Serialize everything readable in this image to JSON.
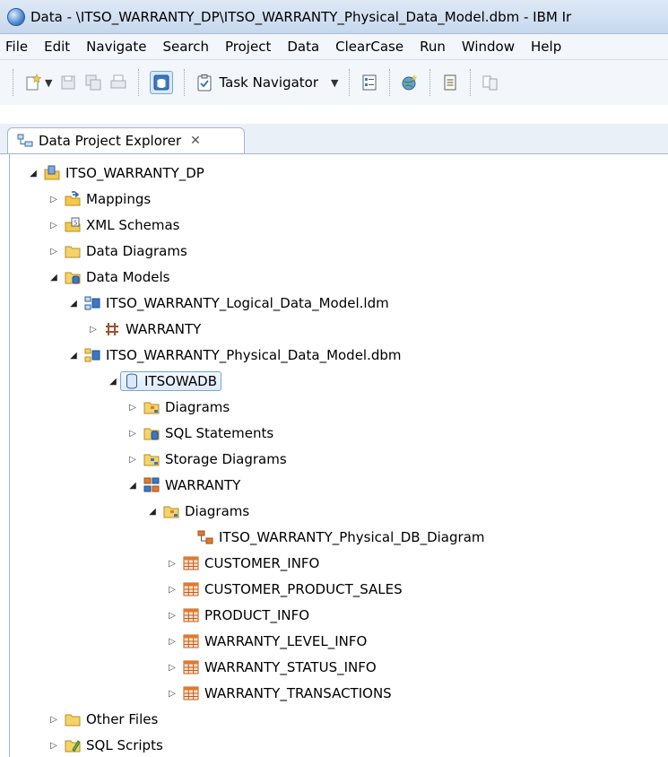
{
  "window": {
    "title": "Data - \\ITSO_WARRANTY_DP\\ITSO_WARRANTY_Physical_Data_Model.dbm - IBM Ir"
  },
  "menu": [
    "File",
    "Edit",
    "Navigate",
    "Search",
    "Project",
    "Data",
    "ClearCase",
    "Run",
    "Window",
    "Help"
  ],
  "toolbar": {
    "task_navigator_label": "Task Navigator"
  },
  "tab": {
    "label": "Data Project Explorer",
    "close_glyph": "✕"
  },
  "tree": [
    {
      "label": "ITSO_WARRANTY_DP",
      "icon": "project-icon",
      "expanded": true
    },
    {
      "label": "Mappings",
      "icon": "mappings-folder-icon",
      "expanded": false
    },
    {
      "label": "XML Schemas",
      "icon": "xml-schemas-folder-icon",
      "expanded": false
    },
    {
      "label": "Data Diagrams",
      "icon": "folder-icon",
      "expanded": false
    },
    {
      "label": "Data Models",
      "icon": "data-models-folder-icon",
      "expanded": true
    },
    {
      "label": "ITSO_WARRANTY_Logical_Data_Model.ldm",
      "icon": "logical-model-icon",
      "expanded": true
    },
    {
      "label": "WARRANTY",
      "icon": "package-icon",
      "expanded": false
    },
    {
      "label": "ITSO_WARRANTY_Physical_Data_Model.dbm",
      "icon": "physical-model-icon",
      "expanded": true
    },
    {
      "label": "ITSOWADB",
      "icon": "database-icon",
      "expanded": true,
      "selected": true
    },
    {
      "label": "Diagrams",
      "icon": "diagrams-folder-icon",
      "expanded": false
    },
    {
      "label": "SQL Statements",
      "icon": "sql-statements-folder-icon",
      "expanded": false
    },
    {
      "label": "Storage Diagrams",
      "icon": "storage-diagrams-folder-icon",
      "expanded": false
    },
    {
      "label": "WARRANTY",
      "icon": "schema-icon",
      "expanded": true
    },
    {
      "label": "Diagrams",
      "icon": "diagrams-folder-icon",
      "expanded": true
    },
    {
      "label": "ITSO_WARRANTY_Physical_DB_Diagram",
      "icon": "diagram-icon"
    },
    {
      "label": "CUSTOMER_INFO",
      "icon": "table-icon",
      "expanded": false
    },
    {
      "label": "CUSTOMER_PRODUCT_SALES",
      "icon": "table-icon",
      "expanded": false
    },
    {
      "label": "PRODUCT_INFO",
      "icon": "table-icon",
      "expanded": false
    },
    {
      "label": "WARRANTY_LEVEL_INFO",
      "icon": "table-icon",
      "expanded": false
    },
    {
      "label": "WARRANTY_STATUS_INFO",
      "icon": "table-icon",
      "expanded": false
    },
    {
      "label": "WARRANTY_TRANSACTIONS",
      "icon": "table-icon",
      "expanded": false
    },
    {
      "label": "Other Files",
      "icon": "folder-icon",
      "expanded": false
    },
    {
      "label": "SQL Scripts",
      "icon": "sql-scripts-folder-icon",
      "expanded": false
    }
  ],
  "colors": {
    "selection": "#dcebfc",
    "folder": "#f2c94c",
    "table": "#e07a2e",
    "accent": "#3a78c4"
  }
}
